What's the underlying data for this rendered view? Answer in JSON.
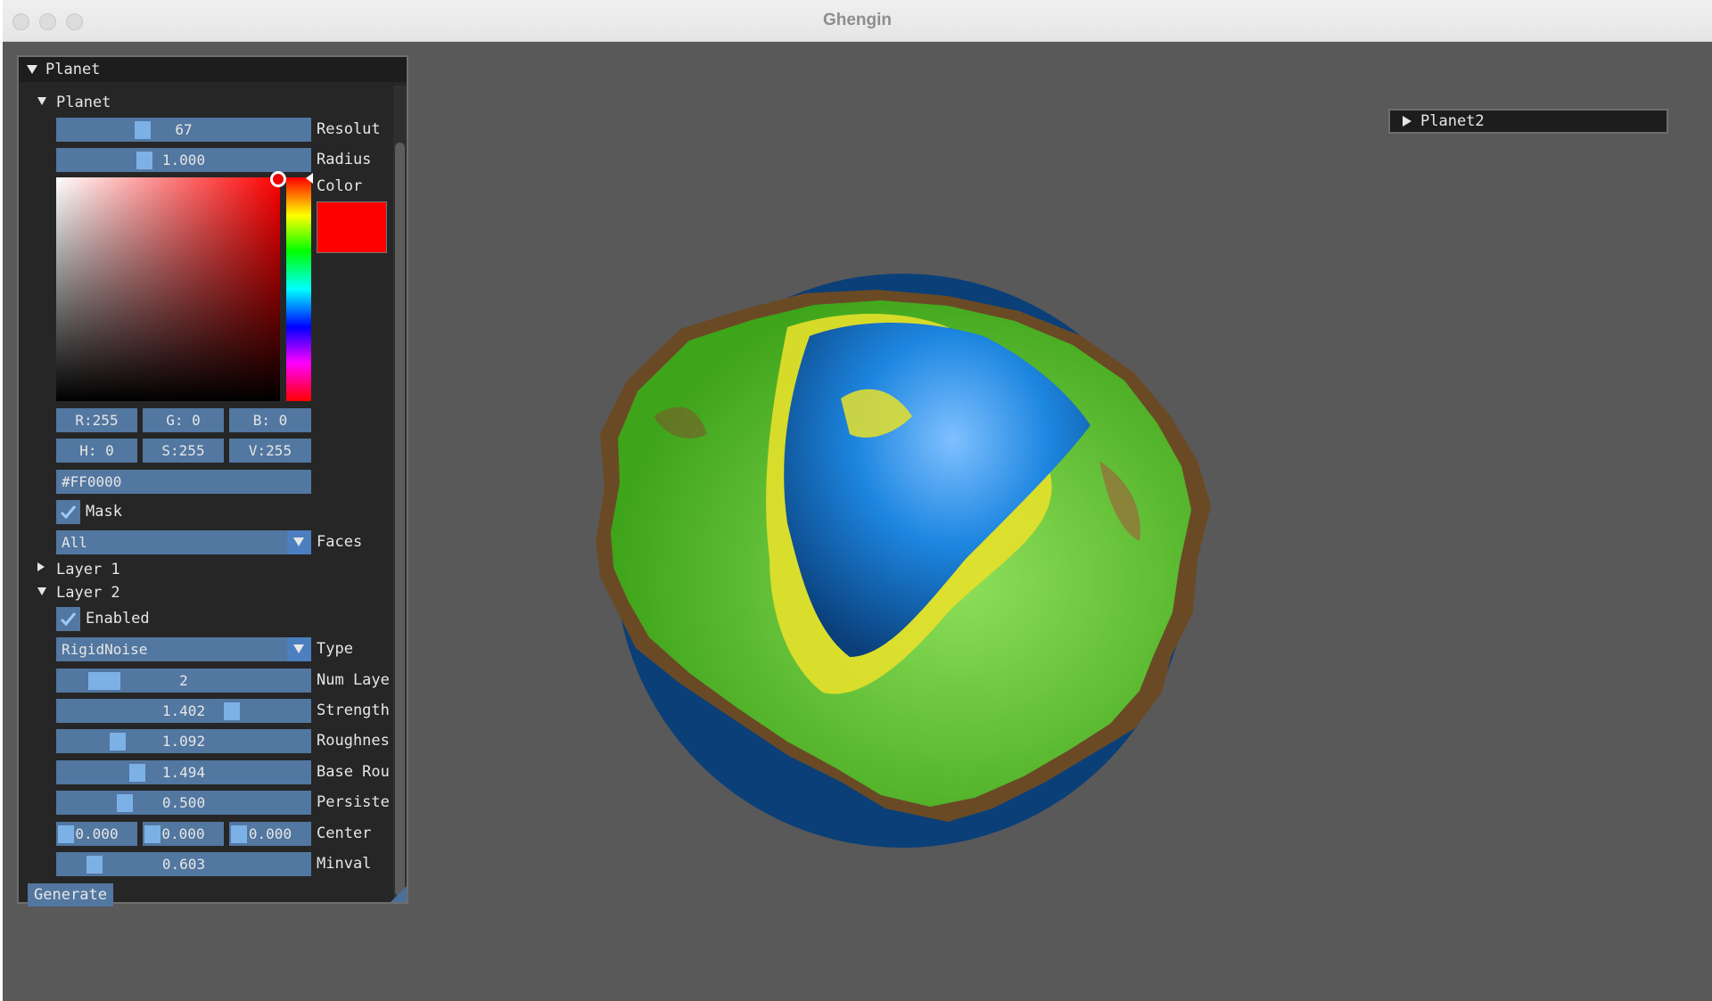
{
  "window": {
    "title": "Ghengin"
  },
  "panel": {
    "title": "Planet",
    "section": "Planet",
    "resolution": {
      "value": "67",
      "label": "Resolut",
      "fraction": 0.33
    },
    "radius": {
      "value": "1.000",
      "label": "Radius",
      "fraction": 0.34
    },
    "color": {
      "label": "Color",
      "swatch": "#ff0000",
      "r": "R:255",
      "g": "G:  0",
      "b": "B:  0",
      "h": "H:  0",
      "s": "S:255",
      "v": "V:255",
      "hex": "#FF0000"
    },
    "mask": {
      "label": "Mask",
      "checked": true
    },
    "faces": {
      "value": "All",
      "label": "Faces"
    },
    "layer1": {
      "label": "Layer 1"
    },
    "layer2": {
      "label": "Layer 2",
      "enabled": {
        "label": "Enabled",
        "checked": true
      },
      "type": {
        "value": "RigidNoise",
        "label": "Type"
      },
      "num_layers": {
        "value": "2",
        "label": "Num Laye",
        "fraction": 0.18
      },
      "strength": {
        "value": "1.402",
        "label": "Strength",
        "fraction": 0.68
      },
      "roughness": {
        "value": "1.092",
        "label": "Roughnes",
        "fraction": 0.24
      },
      "base_roughness": {
        "value": "1.494",
        "label": "Base Rou",
        "fraction": 0.31
      },
      "persistence": {
        "value": "0.500",
        "label": "Persiste",
        "fraction": 0.28
      },
      "center": {
        "x": "0.000",
        "y": "0.000",
        "z": "0.000",
        "label": "Center"
      },
      "minval": {
        "value": "0.603",
        "label": "Minval",
        "fraction": 0.15
      }
    },
    "generate": "Generate"
  },
  "planet2": {
    "title": "Planet2"
  }
}
